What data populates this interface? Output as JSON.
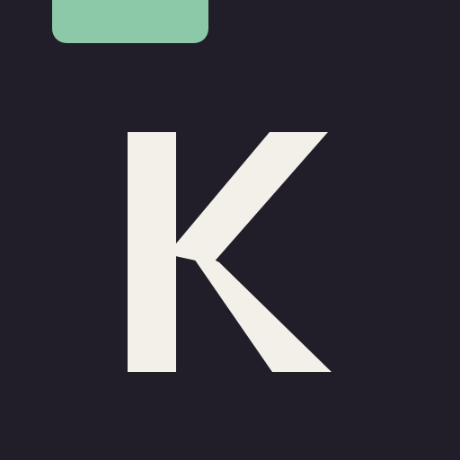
{
  "logo": {
    "letter": "K",
    "colors": {
      "background": "#211e29",
      "tab": "#8bc9a8",
      "letter": "#f3f0ea"
    }
  }
}
